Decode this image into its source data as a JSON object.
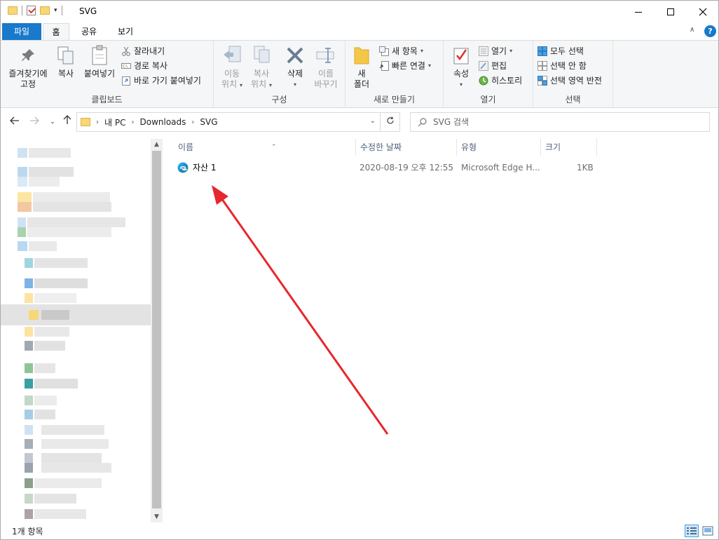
{
  "window": {
    "title": "SVG"
  },
  "ribbon": {
    "tabs": [
      {
        "label": "파일"
      },
      {
        "label": "홈"
      },
      {
        "label": "공유"
      },
      {
        "label": "보기"
      }
    ],
    "help": "?",
    "clipboard": {
      "label": "클립보드",
      "pin": "즐겨찾기에",
      "pin2": "고정",
      "copy": "복사",
      "paste": "붙여넣기",
      "cut": "잘라내기",
      "copy_path": "경로 복사",
      "paste_shortcut": "바로 가기 붙여넣기"
    },
    "organize": {
      "label": "구성",
      "move_to": "이동",
      "move_to2": "위치",
      "copy_to": "복사",
      "copy_to2": "위치",
      "delete": "삭제",
      "rename": "이름",
      "rename2": "바꾸기"
    },
    "new": {
      "label": "새로 만들기",
      "new_folder": "새",
      "new_folder2": "폴더",
      "new_item": "새 항목",
      "easy_access": "빠른 연결"
    },
    "open": {
      "label": "열기",
      "properties": "속성",
      "open": "열기",
      "edit": "편집",
      "history": "히스토리"
    },
    "select": {
      "label": "선택",
      "select_all": "모두 선택",
      "select_none": "선택 안 함",
      "invert": "선택 영역 반전"
    }
  },
  "address": {
    "crumbs": [
      "내 PC",
      "Downloads",
      "SVG"
    ],
    "search_placeholder": "SVG 검색"
  },
  "columns": {
    "name": "이름",
    "date": "수정한 날짜",
    "type": "유형",
    "size": "크기"
  },
  "files": [
    {
      "name": "자산 1",
      "date": "2020-08-19 오후 12:55",
      "type": "Microsoft Edge H...",
      "size": "1KB",
      "icon": "edge-icon"
    }
  ],
  "status": {
    "count": "1개 항목"
  },
  "colors": {
    "accent": "#1979ca",
    "annotation": "#e8262d"
  }
}
